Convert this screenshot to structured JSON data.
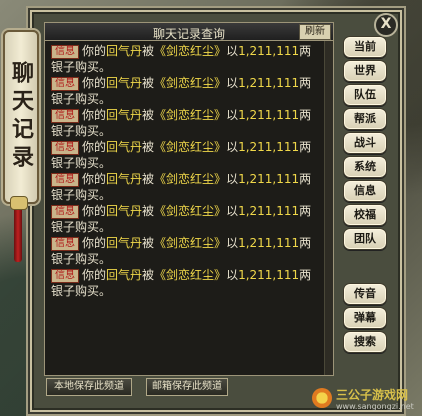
{
  "window": {
    "header_title": "聊天记录查询",
    "refresh_label": "刷新",
    "close_label": "X"
  },
  "side_title": "聊天记录",
  "messages": [
    {
      "tag": "信息",
      "text_a": "你的",
      "item": "回气丹",
      "text_b": "被",
      "seller": "《剑恋红尘》",
      "text_c": "以",
      "price": "1,211,111",
      "text_d": "两",
      "line2": "银子购买。"
    },
    {
      "tag": "信息",
      "text_a": "你的",
      "item": "回气丹",
      "text_b": "被",
      "seller": "《剑恋红尘》",
      "text_c": "以",
      "price": "1,211,111",
      "text_d": "两",
      "line2": "银子购买。"
    },
    {
      "tag": "信息",
      "text_a": "你的",
      "item": "回气丹",
      "text_b": "被",
      "seller": "《剑恋红尘》",
      "text_c": "以",
      "price": "1,211,111",
      "text_d": "两",
      "line2": "银子购买。"
    },
    {
      "tag": "信息",
      "text_a": "你的",
      "item": "回气丹",
      "text_b": "被",
      "seller": "《剑恋红尘》",
      "text_c": "以",
      "price": "1,211,111",
      "text_d": "两",
      "line2": "银子购买。"
    },
    {
      "tag": "信息",
      "text_a": "你的",
      "item": "回气丹",
      "text_b": "被",
      "seller": "《剑恋红尘》",
      "text_c": "以",
      "price": "1,211,111",
      "text_d": "两",
      "line2": "银子购买。"
    },
    {
      "tag": "信息",
      "text_a": "你的",
      "item": "回气丹",
      "text_b": "被",
      "seller": "《剑恋红尘》",
      "text_c": "以",
      "price": "1,211,111",
      "text_d": "两",
      "line2": "银子购买。"
    },
    {
      "tag": "信息",
      "text_a": "你的",
      "item": "回气丹",
      "text_b": "被",
      "seller": "《剑恋红尘》",
      "text_c": "以",
      "price": "1,211,111",
      "text_d": "两",
      "line2": "银子购买。"
    },
    {
      "tag": "信息",
      "text_a": "你的",
      "item": "回气丹",
      "text_b": "被",
      "seller": "《剑恋红尘》",
      "text_c": "以",
      "price": "1,211,111",
      "text_d": "两",
      "line2": "银子购买。"
    }
  ],
  "side_buttons": [
    "当前",
    "世界",
    "队伍",
    "帮派",
    "战斗",
    "系统",
    "信息",
    "校福",
    "团队",
    "传音",
    "弹幕",
    "搜索"
  ],
  "bottom_buttons": {
    "local_save": "本地保存此频道",
    "mail_save": "邮箱保存此频道"
  },
  "watermark": {
    "name": "三公子游戏网",
    "url": "www.sangongzi.net"
  },
  "colors": {
    "item_text": "#f0d84a",
    "tag_text": "#b01818",
    "panel_bg": "#1d1c18"
  }
}
